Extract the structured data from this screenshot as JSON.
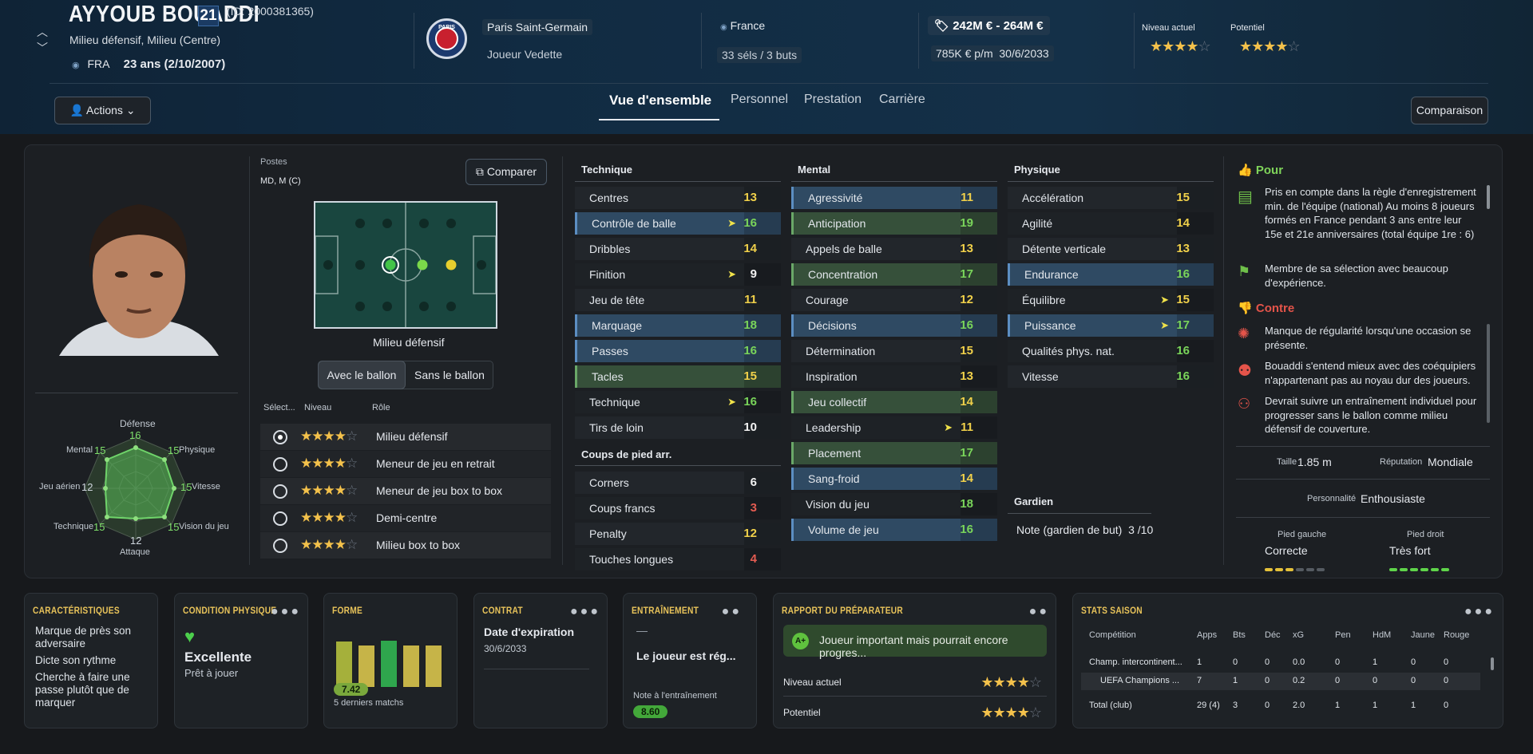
{
  "player": {
    "name": "AYYOUB BOUADDI",
    "number": "21",
    "id": "(ID: 2000381365)",
    "positions": "Milieu défensif, Milieu (Centre)",
    "nationality": "FRA",
    "age": "23 ans (2/10/2007)"
  },
  "club": {
    "name": "Paris Saint-Germain",
    "status": "Joueur Vedette",
    "logo_text": "PARIS"
  },
  "country": {
    "name": "France",
    "caps": "33 séls / 3 buts"
  },
  "value": {
    "range": "242M € - 264M €",
    "wage": "785K € p/m",
    "contract_end": "30/6/2033"
  },
  "ability": {
    "current_label": "Niveau actuel",
    "potential_label": "Potentiel",
    "current_stars": "★★★★",
    "current_empty": "☆",
    "potential_stars": "★★★★",
    "potential_empty": "☆"
  },
  "nav": {
    "actions": "Actions",
    "tabs": [
      "Vue d'ensemble",
      "Personnel",
      "Prestation",
      "Carrière"
    ],
    "compare": "Comparaison"
  },
  "positions_panel": {
    "label": "Postes",
    "value": "MD, M (C)",
    "compare_btn": "Comparer",
    "role_label": "Milieu défensif",
    "toggle_on": "Avec le ballon",
    "toggle_off": "Sans le ballon",
    "col_select": "Sélect...",
    "col_level": "Niveau",
    "col_role": "Rôle",
    "roles": [
      {
        "name": "Milieu défensif",
        "stars": "★★★★",
        "empty": "☆",
        "selected": true
      },
      {
        "name": "Meneur de jeu en retrait",
        "stars": "★★★★",
        "empty": "☆",
        "selected": false
      },
      {
        "name": "Meneur de jeu box to box",
        "stars": "★★★★",
        "empty": "☆",
        "selected": false
      },
      {
        "name": "Demi-centre",
        "stars": "★★★★",
        "empty": "☆",
        "selected": false
      },
      {
        "name": "Milieu box to box",
        "stars": "★★★★",
        "empty": "☆",
        "selected": false
      }
    ]
  },
  "radar": {
    "labels": [
      {
        "name": "Défense",
        "value": "16"
      },
      {
        "name": "Physique",
        "value": "15"
      },
      {
        "name": "Vitesse",
        "value": "15"
      },
      {
        "name": "Vision du jeu",
        "value": "15"
      },
      {
        "name": "Attaque",
        "value": "12"
      },
      {
        "name": "Technique",
        "value": "15"
      },
      {
        "name": "Jeu aérien",
        "value": "12"
      },
      {
        "name": "Mental",
        "value": "15"
      }
    ]
  },
  "technique": {
    "title": "Technique",
    "rows": [
      {
        "n": "Centres",
        "v": "13",
        "c": "vyellow",
        "bg": "rdark"
      },
      {
        "n": "Contrôle de balle",
        "v": "16",
        "c": "vgreen",
        "bg": "rblue",
        "arrow": true
      },
      {
        "n": "Dribbles",
        "v": "14",
        "c": "vyellow",
        "bg": "rdark"
      },
      {
        "n": "Finition",
        "v": "9",
        "c": "vwhite",
        "bg": "rdark2",
        "arrow": true
      },
      {
        "n": "Jeu de tête",
        "v": "11",
        "c": "vyellow",
        "bg": "rdark"
      },
      {
        "n": "Marquage",
        "v": "18",
        "c": "vgreen",
        "bg": "rblue"
      },
      {
        "n": "Passes",
        "v": "16",
        "c": "vgreen",
        "bg": "rblue"
      },
      {
        "n": "Tacles",
        "v": "15",
        "c": "vyellow",
        "bg": "rgreen"
      },
      {
        "n": "Technique",
        "v": "16",
        "c": "vgreen",
        "bg": "rdark2",
        "arrow": true
      },
      {
        "n": "Tirs de loin",
        "v": "10",
        "c": "vwhite",
        "bg": "rdark"
      }
    ]
  },
  "setpieces": {
    "title": "Coups de pied arr.",
    "rows": [
      {
        "n": "Corners",
        "v": "6",
        "c": "vwhite",
        "bg": "rdark"
      },
      {
        "n": "Coups francs",
        "v": "3",
        "c": "vred",
        "bg": "rdark2"
      },
      {
        "n": "Penalty",
        "v": "12",
        "c": "vyellow",
        "bg": "rdark"
      },
      {
        "n": "Touches longues",
        "v": "4",
        "c": "vred",
        "bg": "rdark2"
      }
    ]
  },
  "mental": {
    "title": "Mental",
    "rows": [
      {
        "n": "Agressivité",
        "v": "11",
        "c": "vyellow",
        "bg": "rblue"
      },
      {
        "n": "Anticipation",
        "v": "19",
        "c": "vgreen",
        "bg": "rgreen"
      },
      {
        "n": "Appels de balle",
        "v": "13",
        "c": "vyellow",
        "bg": "rdark"
      },
      {
        "n": "Concentration",
        "v": "17",
        "c": "vgreen",
        "bg": "rgreen"
      },
      {
        "n": "Courage",
        "v": "12",
        "c": "vyellow",
        "bg": "rdark"
      },
      {
        "n": "Décisions",
        "v": "16",
        "c": "vgreen",
        "bg": "rblue"
      },
      {
        "n": "Détermination",
        "v": "15",
        "c": "vyellow",
        "bg": "rdark"
      },
      {
        "n": "Inspiration",
        "v": "13",
        "c": "vyellow",
        "bg": "rdark2"
      },
      {
        "n": "Jeu collectif",
        "v": "14",
        "c": "vyellow",
        "bg": "rgreen"
      },
      {
        "n": "Leadership",
        "v": "11",
        "c": "vyellow",
        "bg": "rdark2",
        "arrow": true
      },
      {
        "n": "Placement",
        "v": "17",
        "c": "vgreen",
        "bg": "rgreen"
      },
      {
        "n": "Sang-froid",
        "v": "14",
        "c": "vyellow",
        "bg": "rblue"
      },
      {
        "n": "Vision du jeu",
        "v": "18",
        "c": "vgreen",
        "bg": "rdark2"
      },
      {
        "n": "Volume de jeu",
        "v": "16",
        "c": "vgreen",
        "bg": "rblue"
      }
    ]
  },
  "physique": {
    "title": "Physique",
    "rows": [
      {
        "n": "Accélération",
        "v": "15",
        "c": "vyellow",
        "bg": "rdark"
      },
      {
        "n": "Agilité",
        "v": "14",
        "c": "vyellow",
        "bg": "rdark2"
      },
      {
        "n": "Détente verticale",
        "v": "13",
        "c": "vyellow",
        "bg": "rdark"
      },
      {
        "n": "Endurance",
        "v": "16",
        "c": "vgreen",
        "bg": "rblue"
      },
      {
        "n": "Équilibre",
        "v": "15",
        "c": "vyellow",
        "bg": "rdark2",
        "arrow": true
      },
      {
        "n": "Puissance",
        "v": "17",
        "c": "vgreen",
        "bg": "rblue",
        "arrow": true
      },
      {
        "n": "Qualités phys. nat.",
        "v": "16",
        "c": "vgreen",
        "bg": "rdark2"
      },
      {
        "n": "Vitesse",
        "v": "16",
        "c": "vgreen",
        "bg": "rdark"
      }
    ]
  },
  "goalkeeper": {
    "title": "Gardien",
    "label": "Note (gardien de but)",
    "value": "3 /10"
  },
  "pros": {
    "title": "Pour",
    "items": [
      "Pris en compte dans la règle d'enregistrement min. de l'équipe (national) Au moins 8 joueurs formés en France pendant 3 ans entre leur 15e et 21e anniversaires (total équipe 1re : 6)",
      "Membre de sa sélection avec beaucoup d'expérience."
    ]
  },
  "cons": {
    "title": "Contre",
    "items": [
      "Manque de régularité lorsqu'une occasion se présente.",
      "Bouaddi s'entend mieux avec des coéquipiers n'appartenant pas au noyau dur des joueurs.",
      "Devrait suivre un entraînement individuel pour progresser sans le ballon comme milieu défensif de couverture."
    ]
  },
  "info": {
    "height_label": "Taille",
    "height": "1.85 m",
    "rep_label": "Réputation",
    "rep": "Mondiale",
    "pers_label": "Personnalité",
    "pers": "Enthousiaste",
    "lfoot_label": "Pied gauche",
    "lfoot": "Correcte",
    "rfoot_label": "Pied droit",
    "rfoot": "Très fort",
    "lfoot_level": 3,
    "rfoot_level": 6
  },
  "cards": {
    "carac": {
      "title": "CARACTÉRISTIQUES",
      "items": [
        "Marque de près son adversaire",
        "Dicte son rythme",
        "Cherche à faire une passe plutôt que de marquer"
      ]
    },
    "condition": {
      "title": "CONDITION PHYSIQUE",
      "value": "Excellente",
      "sub": "Prêt à jouer"
    },
    "forme": {
      "title": "FORME",
      "avg": "7.42",
      "sub": "5 derniers matchs",
      "bars": [
        0.78,
        0.72,
        0.8,
        0.72,
        0.72
      ]
    },
    "contrat": {
      "title": "CONTRAT",
      "label": "Date d'expiration",
      "date": "30/6/2033"
    },
    "entrainement": {
      "title": "ENTRAÎNEMENT",
      "dash": "—",
      "text": "Le joueur est rég...",
      "note_label": "Note à l'entraînement",
      "note": "8.60"
    },
    "rapport": {
      "title": "RAPPORT DU PRÉPARATEUR",
      "grade": "A+",
      "summary": "Joueur important mais pourrait encore progres...",
      "current_label": "Niveau actuel",
      "potential_label": "Potentiel",
      "current_stars": "★★★★",
      "potential_stars": "★★★★",
      "empty": "☆"
    },
    "stats": {
      "title": "STATS SAISON",
      "headers": [
        "Compétition",
        "Apps",
        "Bts",
        "Déc",
        "xG",
        "Pen",
        "HdM",
        "Jaune",
        "Rouge"
      ],
      "rows": [
        [
          "Champ. intercontinent...",
          "1",
          "0",
          "0",
          "0.0",
          "0",
          "1",
          "0",
          "0"
        ],
        [
          "UEFA Champions ...",
          "7",
          "1",
          "0",
          "0.2",
          "0",
          "0",
          "0",
          "0"
        ],
        [
          "Total (club)",
          "29 (4)",
          "3",
          "0",
          "2.0",
          "1",
          "1",
          "1",
          "0"
        ]
      ]
    }
  }
}
